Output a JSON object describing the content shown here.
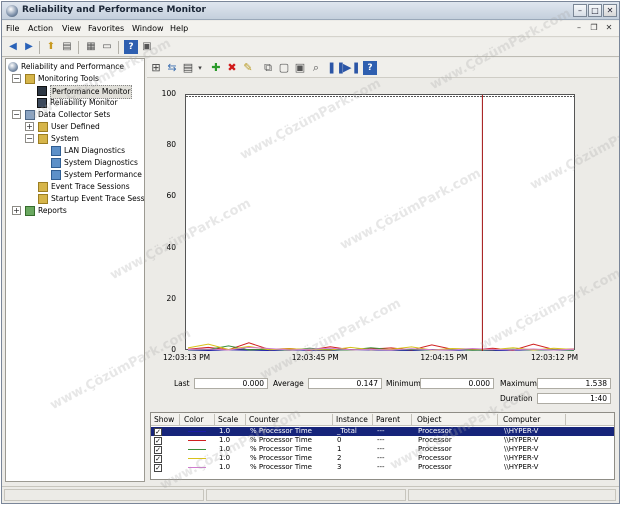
{
  "window": {
    "title": "Reliability and Performance Monitor"
  },
  "menu": [
    "File",
    "Action",
    "View",
    "Favorites",
    "Window",
    "Help"
  ],
  "tree": {
    "root": "Reliability and Performance",
    "monitoring_tools": "Monitoring Tools",
    "performance_monitor": "Performance Monitor",
    "reliability_monitor": "Reliability Monitor",
    "data_collector_sets": "Data Collector Sets",
    "user_defined": "User Defined",
    "system": "System",
    "lan_diagnostics": "LAN Diagnostics",
    "system_diagnostics": "System Diagnostics",
    "system_performance": "System Performance",
    "event_trace_sessions": "Event Trace Sessions",
    "startup_event_trace": "Startup Event Trace Sess",
    "reports": "Reports"
  },
  "chart_data": {
    "type": "line",
    "y_ticks": [
      "100",
      "80",
      "60",
      "40",
      "20",
      "0"
    ],
    "x_ticks": [
      "12:03:13 PM",
      "12:03:45 PM",
      "12:04:15 PM",
      "12:03:12 PM"
    ],
    "ylim": [
      0,
      100
    ],
    "grid": false,
    "series": [
      {
        "name": "_Total",
        "color": "#1a1aa8",
        "values": [
          0.2,
          0,
          0.3,
          0.1,
          0,
          0.2,
          0.1,
          0,
          0.4,
          0.2,
          0.1,
          0,
          0.3,
          0.1,
          0.2,
          0,
          0.1,
          0.3,
          0.2,
          0.1
        ]
      },
      {
        "name": "0",
        "color": "#d02020",
        "values": [
          0.5,
          1.2,
          0.3,
          3.0,
          0.4,
          0.8,
          0.2,
          1.5,
          0.3,
          0.6,
          1.0,
          0.2,
          2.2,
          0.5,
          0.3,
          0.9,
          0.1,
          2.5,
          0.4,
          0.6
        ]
      },
      {
        "name": "1",
        "color": "#3a8f3a",
        "values": [
          0.3,
          0.4,
          1.8,
          0.2,
          0.5,
          0.1,
          0.9,
          0.3,
          0.2,
          1.1,
          0.3,
          0.4,
          0.2,
          0.6,
          0.1,
          0.3,
          0.5,
          0.2,
          0.4,
          0.1
        ]
      },
      {
        "name": "2",
        "color": "#d8c21a",
        "values": [
          1.0,
          2.5,
          0.4,
          1.6,
          0.3,
          0.7,
          0.4,
          0.2,
          1.2,
          0.3,
          0.5,
          1.4,
          0.2,
          0.8,
          0.6,
          0.3,
          1.1,
          0.2,
          0.9,
          0.4
        ]
      },
      {
        "name": "3",
        "color": "#d27ad0",
        "values": [
          0.4,
          0.6,
          0.2,
          1.2,
          0.8,
          0.2,
          0.5,
          0.9,
          0.3,
          0.4,
          0.2,
          0.7,
          0.3,
          0.2,
          0.8,
          0.4,
          0.3,
          0.6,
          0.2,
          0.5
        ]
      }
    ],
    "time_marker": 0.76
  },
  "stats": {
    "last_label": "Last",
    "last": "0.000",
    "average_label": "Average",
    "average": "0.147",
    "minimum_label": "Minimum",
    "minimum": "0.000",
    "maximum_label": "Maximum",
    "maximum": "1.538",
    "duration_label": "Duration",
    "duration": "1:40"
  },
  "grid": {
    "headers": [
      "Show",
      "Color",
      "Scale",
      "Counter",
      "Instance",
      "Parent",
      "Object",
      "Computer"
    ],
    "rows": [
      {
        "scale": "1.0",
        "counter": "% Processor Time",
        "instance": "_Total",
        "parent": "---",
        "object": "Processor",
        "computer": "\\\\HYPER-V",
        "color": "#1a1aa8"
      },
      {
        "scale": "1.0",
        "counter": "% Processor Time",
        "instance": "0",
        "parent": "---",
        "object": "Processor",
        "computer": "\\\\HYPER-V",
        "color": "#d02020"
      },
      {
        "scale": "1.0",
        "counter": "% Processor Time",
        "instance": "1",
        "parent": "---",
        "object": "Processor",
        "computer": "\\\\HYPER-V",
        "color": "#3a8f3a"
      },
      {
        "scale": "1.0",
        "counter": "% Processor Time",
        "instance": "2",
        "parent": "---",
        "object": "Processor",
        "computer": "\\\\HYPER-V",
        "color": "#d8c21a"
      },
      {
        "scale": "1.0",
        "counter": "% Processor Time",
        "instance": "3",
        "parent": "---",
        "object": "Processor",
        "computer": "\\\\HYPER-V",
        "color": "#d27ad0"
      }
    ]
  },
  "watermark": "www.ÇözümPark.com"
}
